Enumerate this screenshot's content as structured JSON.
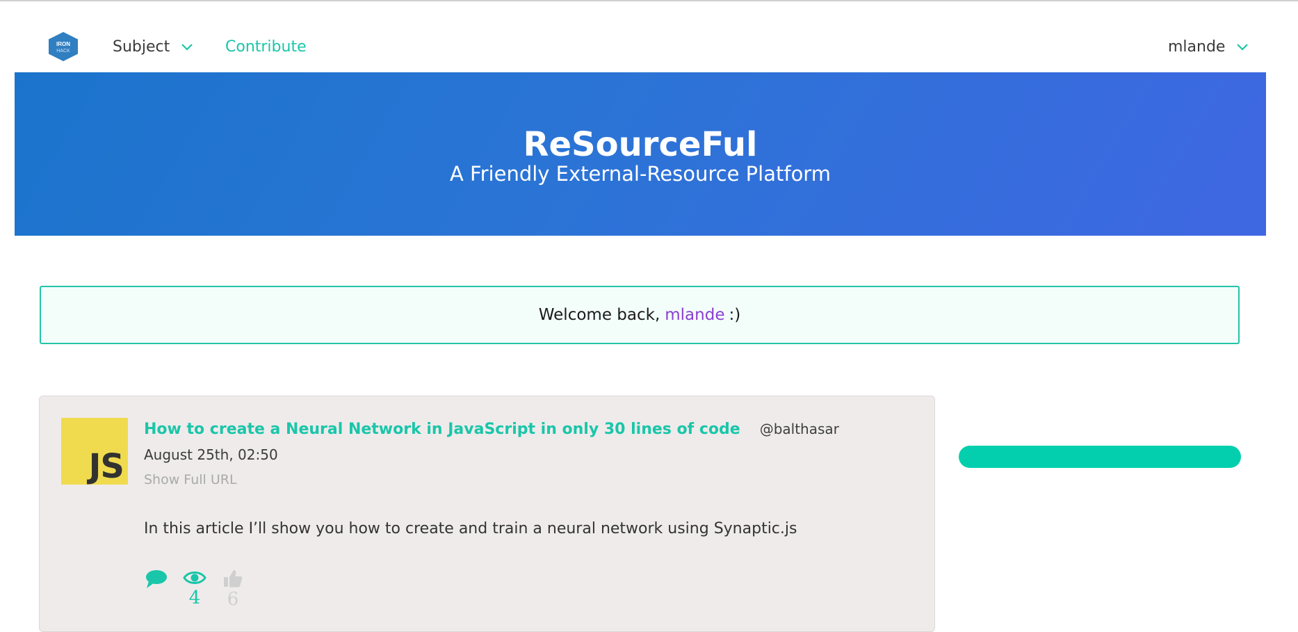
{
  "navbar": {
    "logo_text_top": "IRON",
    "logo_text_bottom": "HACK",
    "subject_label": "Subject",
    "contribute_label": "Contribute",
    "user_label": "mlande"
  },
  "hero": {
    "title": "ReSourceFul",
    "subtitle": "A Friendly External-Resource Platform"
  },
  "welcome": {
    "prefix": "Welcome back,",
    "username": "mlande",
    "suffix": ":)"
  },
  "resource": {
    "thumbnail_text": "JS",
    "title": "How to create a Neural Network in JavaScript in only 30 lines of code",
    "author": "@balthasar",
    "date": "August 25th, 02:50",
    "show_url_label": "Show Full URL",
    "description": "In this article I’ll show you how to create and train a neural network using Synaptic.js",
    "stats": {
      "comment_icon": "comment-icon",
      "views_icon": "eye-icon",
      "views_count": "4",
      "likes_icon": "thumbs-up-icon",
      "likes_count": "6"
    }
  },
  "colors": {
    "accent": "#1ac6a9",
    "hero_start": "#1b74cc",
    "hero_end": "#3f67e2",
    "username": "#8b3fd1",
    "side_bar": "#03cfae"
  }
}
